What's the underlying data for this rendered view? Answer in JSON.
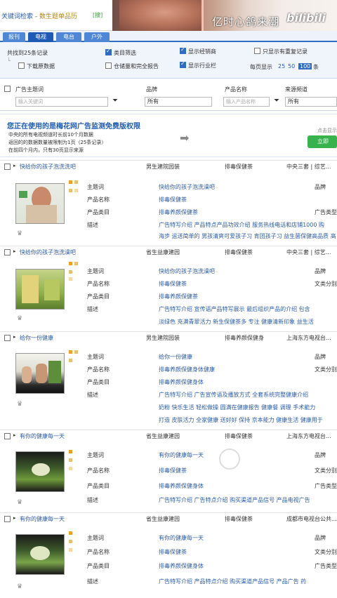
{
  "breadcrumb": {
    "part1": "关键词检索",
    "sep": " - ",
    "part2": "数生题单品历",
    "badge": "[搜]"
  },
  "overlay": {
    "caption": "亿时心鸽来潮",
    "logo": "bilibili"
  },
  "tabs": [
    "报刊",
    "电视",
    "电台",
    "户外"
  ],
  "filters": {
    "row1": [
      "共找到25条记录",
      "类目筛选",
      "显示经销商",
      "只显示有重复记录"
    ],
    "row2": [
      "下载原数据",
      "仓储量和完全报告",
      "显示行业栏",
      "每页显示"
    ],
    "page_sizes": [
      "25",
      "50",
      "100"
    ],
    "page_suffix": "条"
  },
  "columns": {
    "keyword": "广告主题词",
    "keyword_placeholder": "输入关键词",
    "brand": "品牌",
    "brand_value": "所有",
    "product": "产品名称",
    "product_placeholder": "输入产品名称",
    "source": "来源频道",
    "source_value": "所有"
  },
  "notice": {
    "title": "您正在使用的是梅花网广告监测免费版权限",
    "lines": [
      "中央的所有电视频道时长前10个月数据",
      "返回的的数据数量被限制为1页（25条记录）",
      "在前四个月内，只有30页显示来源"
    ],
    "click_hint": "点击显示",
    "button": "立即"
  },
  "labels": {
    "keyword": "主题词",
    "product_name": "产品名称",
    "category": "产品类目",
    "desc": "描述",
    "brand": "品牌",
    "ad_type": "广告类型"
  },
  "records": [
    {
      "title": "快给你的孩子泡洗洗吧",
      "col2": "男生建院园装",
      "col3": "排毒保健茶",
      "col4": "中央三套 | 综艺...",
      "keyword": "快给你的孩子泡洗澡吧",
      "product": "排毒保健茶",
      "category": "排毒养颜保健茶",
      "desc1": "广告特写介绍  产品特点产品功效介绍  服务热线电话和店铺1000  购",
      "desc2": "海步  运送简单的  男孩清爽可爱孩子习  肯团孩子习  益生菌保健高品质  高",
      "r1": "品牌",
      "r2": "广告类型"
    },
    {
      "title": "快给你的孩子泡洗澡吧",
      "col2": "省生益康建园",
      "col3": "排毒保健茶",
      "col4": "中央三套 | 综艺...",
      "keyword": "快给你的孩子泡洗澡吧",
      "product": "排毒保健茶",
      "category": "排毒养颜保健茶",
      "desc1": "广告特写介绍  宣传语产品特写展示  最后组织产品的介绍  包含",
      "desc2": "淡绿色  充满青翠活力  新生保健茶多  专注  健康清新印象  益生活",
      "r1": "品牌",
      "r2": "文类分别"
    },
    {
      "title": "给你一份健康",
      "col2": "男生建院园装",
      "col3": "排毒养颜保健身",
      "col4": "上海东方电视台...",
      "keyword": "给你一份健康",
      "product": "排毒养颜保健身体健康",
      "category": "排毒养颜保健身体",
      "desc1": "广告特写介绍  广告宣传语及播放方式  全套系统完整健康介绍",
      "desc2": "奶粉  快乐生活  轻松做操  圆满在健康报告  健康餐  调理  手术能力",
      "desc3": "打造  皮肤活力  全家健康  送好好  保持  京本能力  健康生活  健康用于",
      "r1": "品牌",
      "r2": "文类分别"
    },
    {
      "title": "有你的健康每一天",
      "col2": "省生益康建园",
      "col3": "排毒保健茶",
      "col4": "上海东方电视台...",
      "keyword": "有你的健康每一天",
      "product": "排毒保健茶",
      "category": "排毒养颜保健身体",
      "desc1": "广告特写介绍  广告特点介绍  购买渠道产品信号  产品电视广告",
      "r1": "品牌",
      "r2": "文类分别",
      "r3": "广告类型"
    },
    {
      "title": "有你的健康每一天",
      "col2": "省生益康建园",
      "col3": "排毒保健茶",
      "col4": "成都市电视台公共...",
      "keyword": "有你的健康每一天",
      "product": "排毒保健茶",
      "category": "排毒养颜保健身体",
      "desc1": "广告特写介绍  产品特点介绍  购买渠道产品信号  产品广告  药",
      "r1": "品牌",
      "r2": "文类分别",
      "r3": "广告类型"
    }
  ],
  "colors": {
    "accent": "#2f6cc4",
    "link": "#2a5caa",
    "badge_orange": "#f0a020",
    "badge_gold": "#e8c070"
  }
}
